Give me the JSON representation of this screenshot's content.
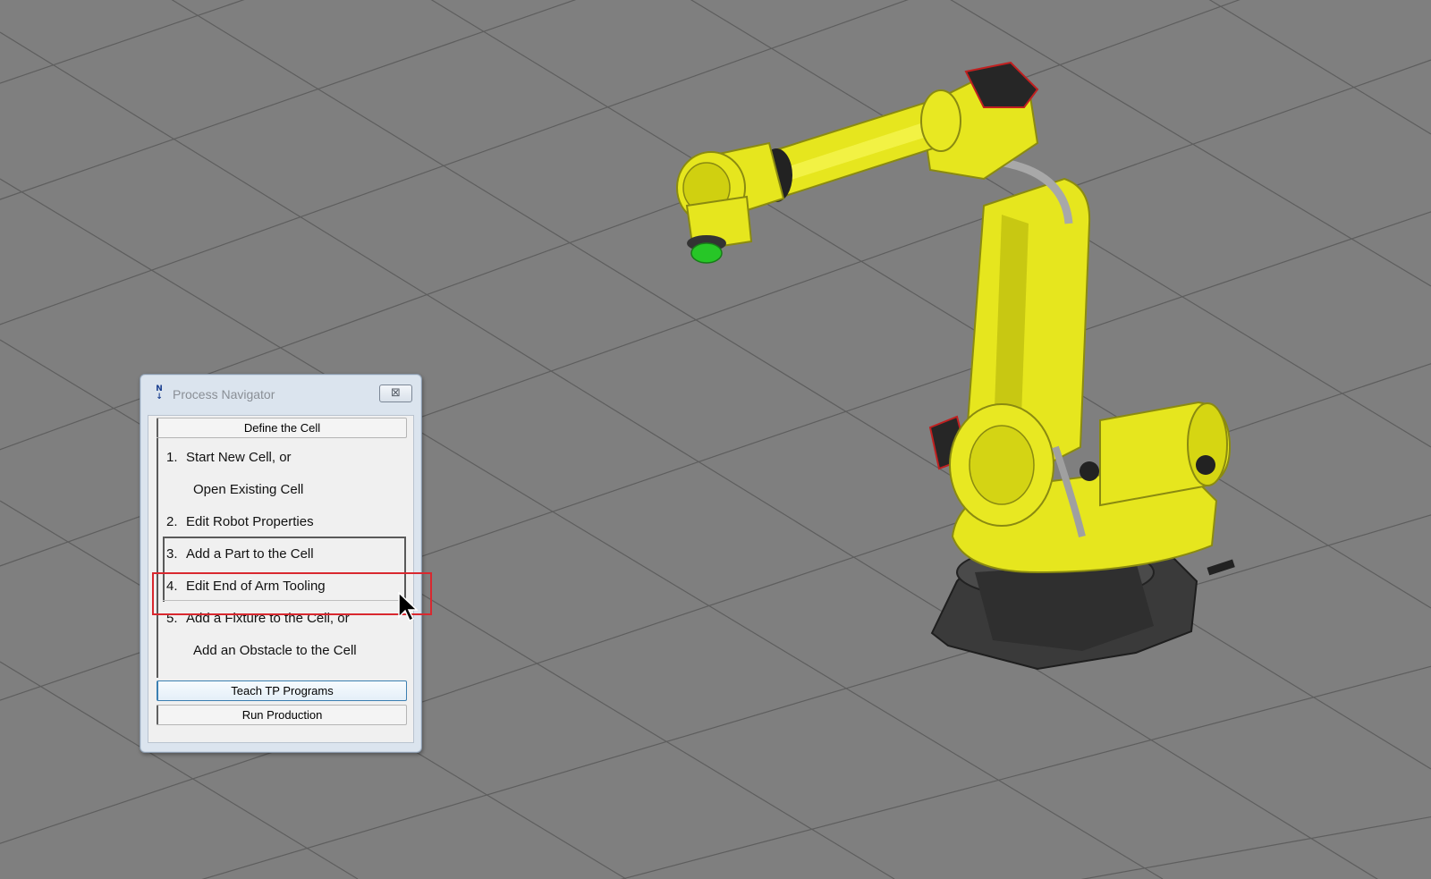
{
  "window": {
    "title": "Process Navigator",
    "icon": "process-navigator-icon",
    "close_glyph": "⊠"
  },
  "navigator": {
    "define_label": "Define the Cell",
    "steps": [
      {
        "num": "1.",
        "label": "Start New Cell, or"
      },
      {
        "num": "",
        "label": "Open Existing Cell"
      },
      {
        "num": "2.",
        "label": "Edit Robot Properties"
      },
      {
        "num": "3.",
        "label": "Add a Part to the Cell"
      },
      {
        "num": "4.",
        "label": "Edit End of Arm Tooling"
      },
      {
        "num": "5.",
        "label": "Add a Fixture to the Cell, or"
      },
      {
        "num": "",
        "label": "Add an Obstacle to the Cell"
      }
    ],
    "teach_label": "Teach TP Programs",
    "run_label": "Run Production"
  },
  "colors": {
    "floor": "#7f7f7f",
    "grid": "#5e5e5e",
    "robot_yellow": "#e6e61e",
    "robot_shadow": "#b8b810",
    "base_gray": "#3c3c3c",
    "highlight": "#d9282f",
    "tool_green": "#27c627"
  }
}
